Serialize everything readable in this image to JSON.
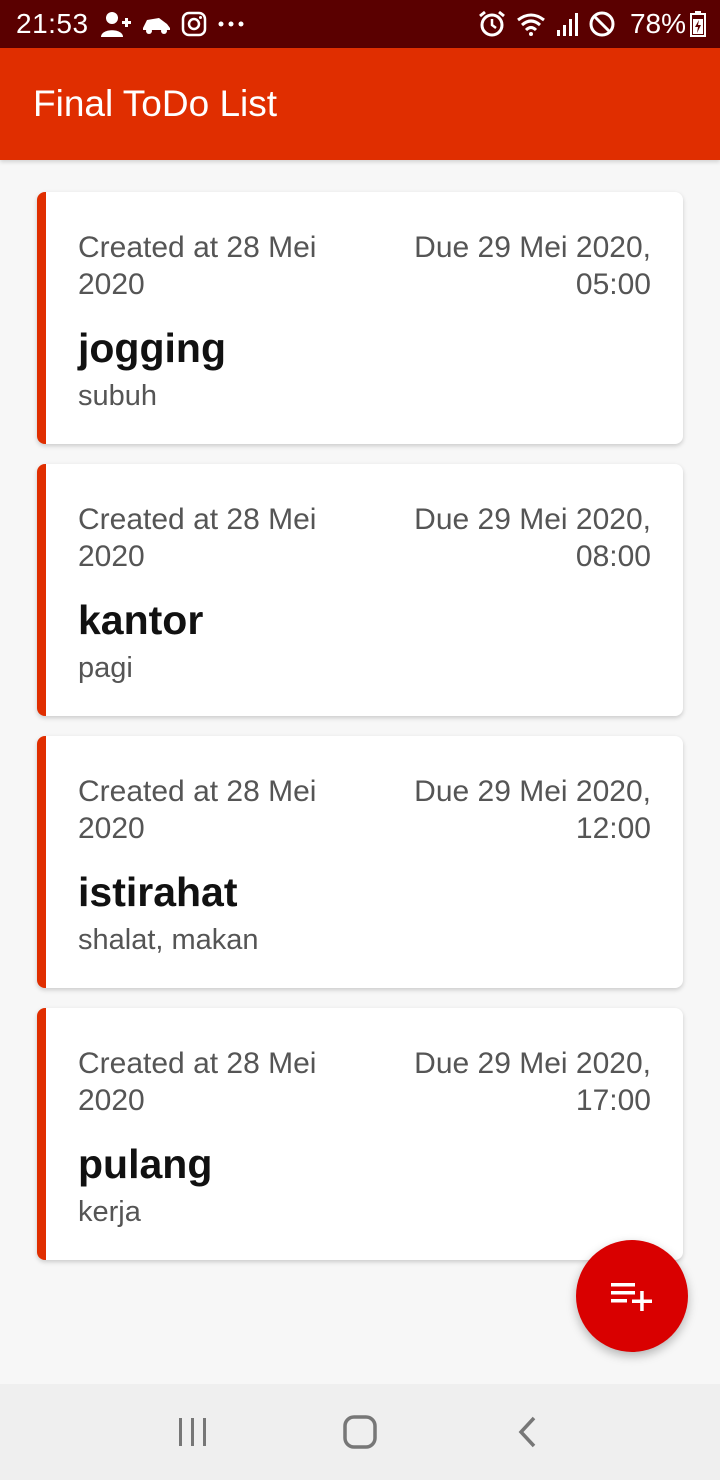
{
  "status_bar": {
    "time": "21:53",
    "battery": "78%",
    "icons": [
      "add-person-icon",
      "car-icon",
      "instagram-icon",
      "more-dots-icon",
      "alarm-icon",
      "wifi-icon",
      "signal-icon",
      "dnd-icon",
      "battery-icon"
    ]
  },
  "app_bar": {
    "title": "Final ToDo List",
    "color": "#e02e00"
  },
  "todos": [
    {
      "created": "Created at 28 Mei 2020",
      "due": "Due 29 Mei 2020, 05:00",
      "title": "jogging",
      "desc": "subuh"
    },
    {
      "created": "Created at 28 Mei 2020",
      "due": "Due 29 Mei 2020, 08:00",
      "title": "kantor",
      "desc": "pagi"
    },
    {
      "created": "Created at 28 Mei 2020",
      "due": "Due 29 Mei 2020, 12:00",
      "title": "istirahat",
      "desc": "shalat, makan"
    },
    {
      "created": "Created at 28 Mei 2020",
      "due": "Due 29 Mei 2020, 17:00",
      "title": "pulang",
      "desc": "kerja"
    }
  ],
  "fab": {
    "icon": "playlist-add-icon",
    "color": "#d90000"
  },
  "nav_bar": {
    "icons": [
      "recents-icon",
      "home-icon",
      "back-icon"
    ]
  }
}
